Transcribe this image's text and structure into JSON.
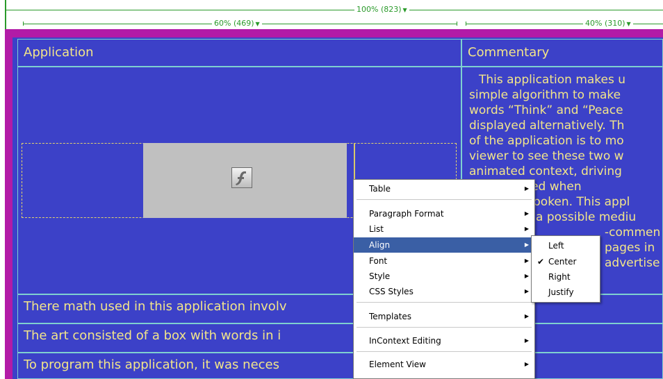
{
  "ruler": {
    "total": "100% (823)",
    "left": "60% (469)",
    "right": "40% (310)"
  },
  "table": {
    "header_app": "Application",
    "header_commentary": "Commentary",
    "commentary_lines": [
      "This application makes u",
      "simple algorithm to make",
      "words “Think” and “Peace",
      "displayed alternatively. Th",
      "of the application is to mo",
      "viewer to see these two w",
      "animated context, driving",
      "conveyed when",
      "poken. This appl",
      "a possible mediu",
      "-commen",
      "pages in",
      "advertise"
    ],
    "row1": "There math used in this application involv",
    "row2": "The art consisted of a box with words in i",
    "row3": "To program this application, it was neces"
  },
  "context_menu": {
    "items": [
      {
        "label": "Table"
      },
      {
        "label": "Paragraph Format"
      },
      {
        "label": "List"
      },
      {
        "label": "Align"
      },
      {
        "label": "Font"
      },
      {
        "label": "Style"
      },
      {
        "label": "CSS Styles"
      },
      {
        "label": "Templates"
      },
      {
        "label": "InContext Editing"
      },
      {
        "label": "Element View"
      }
    ],
    "highlighted": "Align"
  },
  "align_submenu": {
    "items": [
      {
        "label": "Left"
      },
      {
        "label": "Center"
      },
      {
        "label": "Right"
      },
      {
        "label": "Justify"
      }
    ],
    "checked": "Center"
  },
  "colors": {
    "page_bg": "#b21ba7",
    "table_bg": "#3c41c8",
    "text": "#f2e58a",
    "ruler": "#2a9a2a",
    "menu_highlight": "#3a5fa5"
  },
  "icons": {
    "flash": "flash-placeholder-icon",
    "submenu_arrow": "triangle-right-icon",
    "check": "checkmark-icon",
    "dropdown": "triangle-down-icon"
  }
}
